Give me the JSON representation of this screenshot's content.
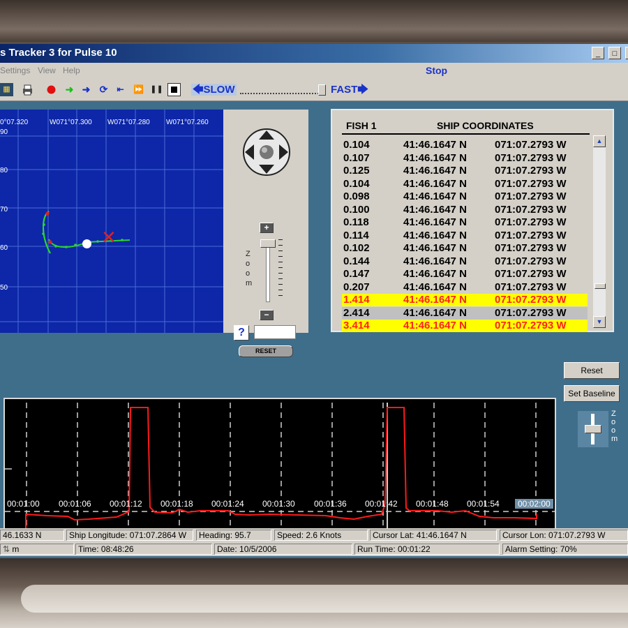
{
  "window": {
    "title": "s Tracker 3 for Pulse 10",
    "controls": [
      "_",
      "□",
      "×"
    ]
  },
  "menu": {
    "items": [
      "Settings",
      "View",
      "Help"
    ],
    "status": "Stop"
  },
  "toolbar": {
    "slow_label": "SLOW",
    "fast_label": "FAST",
    "speed_level": 0.95
  },
  "map": {
    "lon_labels": [
      "0°07.320",
      "W071°07.300",
      "W071°07.280",
      "W071°07.260"
    ],
    "lat_labels": [
      "90",
      "80",
      "70",
      "60",
      "50"
    ],
    "track_color": "#2bd62b",
    "marker_color": "#e02020"
  },
  "controls": {
    "zoom_label": "Zoom",
    "reset_label": "RESET",
    "help_label": "?",
    "plus_label": "+",
    "minus_label": "−",
    "input_value": ""
  },
  "coords": {
    "header_fish": "FISH 1",
    "header_coords": "SHIP COORDINATES",
    "rows": [
      {
        "fish": "0.104",
        "lat": "41:46.1647 N",
        "lon": "071:07.2793 W",
        "hl": ""
      },
      {
        "fish": "0.107",
        "lat": "41:46.1647 N",
        "lon": "071:07.2793 W",
        "hl": ""
      },
      {
        "fish": "0.125",
        "lat": "41:46.1647 N",
        "lon": "071:07.2793 W",
        "hl": ""
      },
      {
        "fish": "0.104",
        "lat": "41:46.1647 N",
        "lon": "071:07.2793 W",
        "hl": ""
      },
      {
        "fish": "0.098",
        "lat": "41:46.1647 N",
        "lon": "071:07.2793 W",
        "hl": ""
      },
      {
        "fish": "0.100",
        "lat": "41:46.1647 N",
        "lon": "071:07.2793 W",
        "hl": ""
      },
      {
        "fish": "0.118",
        "lat": "41:46.1647 N",
        "lon": "071:07.2793 W",
        "hl": ""
      },
      {
        "fish": "0.114",
        "lat": "41:46.1647 N",
        "lon": "071:07.2793 W",
        "hl": ""
      },
      {
        "fish": "0.102",
        "lat": "41:46.1647 N",
        "lon": "071:07.2793 W",
        "hl": ""
      },
      {
        "fish": "0.144",
        "lat": "41:46.1647 N",
        "lon": "071:07.2793 W",
        "hl": ""
      },
      {
        "fish": "0.147",
        "lat": "41:46.1647 N",
        "lon": "071:07.2793 W",
        "hl": ""
      },
      {
        "fish": "0.207",
        "lat": "41:46.1647 N",
        "lon": "071:07.2793 W",
        "hl": ""
      },
      {
        "fish": "1.414",
        "lat": "41:46.1647 N",
        "lon": "071:07.2793 W",
        "hl": "yellow"
      },
      {
        "fish": "2.414",
        "lat": "41:46.1647 N",
        "lon": "071:07.2793 W",
        "hl": "gray"
      },
      {
        "fish": "3.414",
        "lat": "41:46.1647 N",
        "lon": "071:07.2793 W",
        "hl": "yellow"
      }
    ],
    "highlight_color": "#ffff00",
    "highlight_text_color": "#ff2020"
  },
  "graph": {
    "time_labels": [
      "00:01:00",
      "00:01:06",
      "00:01:12",
      "00:01:18",
      "00:01:24",
      "00:01:30",
      "00:01:36",
      "00:01:42",
      "00:01:48",
      "00:01:54",
      "00:02:00"
    ],
    "line_color": "#ff1a1a",
    "reset_label": "Reset",
    "baseline_label": "Set Baseline",
    "zoom_label": "Zoom"
  },
  "status": {
    "row1": {
      "ship_lat": "46.1633 N",
      "ship_lon": "Ship Longitude: 071:07.2864 W",
      "heading": "Heading: 95.7",
      "speed": "Speed: 2.6 Knots",
      "cursor_lat": "Cursor Lat: 41:46.1647 N",
      "cursor_lon": "Cursor Lon: 071:07.2793 W"
    },
    "row2": {
      "depth": "m",
      "time": "Time: 08:48:26",
      "date": "Date: 10/5/2006",
      "run_time": "Run Time: 00:01:22",
      "alarm": "Alarm Setting: 70%"
    }
  }
}
